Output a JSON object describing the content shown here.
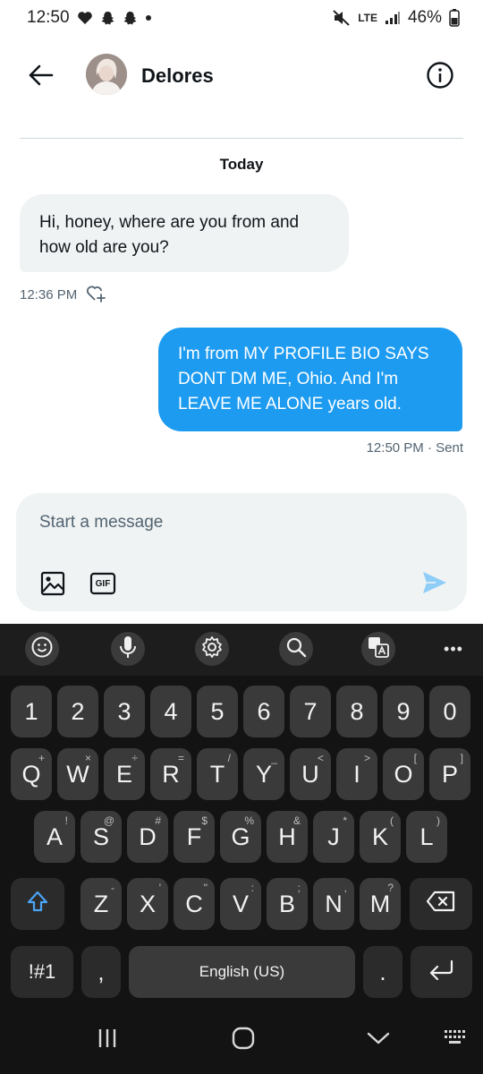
{
  "status_bar": {
    "time": "12:50",
    "network": "LTE",
    "battery": "46%",
    "icons": [
      "heart-icon",
      "snapchat-icon",
      "snapchat-icon",
      "dot-icon",
      "mute-icon",
      "signal-icon",
      "battery-icon"
    ]
  },
  "header": {
    "contact_name": "Delores",
    "back_icon": "arrow-left-icon",
    "info_icon": "info-icon"
  },
  "conversation": {
    "date_label": "Today",
    "messages": [
      {
        "direction": "incoming",
        "text": "Hi, honey, where are you from and how old are you?",
        "time": "12:36 PM"
      },
      {
        "direction": "outgoing",
        "text": "I'm from MY PROFILE BIO SAYS DONT DM ME, Ohio. And I'm LEAVE ME ALONE years old.",
        "time": "12:50 PM · Sent"
      }
    ]
  },
  "composer": {
    "placeholder": "Start a message",
    "gif_label": "GIF",
    "accent_color": "#1d9bf0"
  },
  "keyboard": {
    "toolbar": [
      "emoji-icon",
      "microphone-icon",
      "settings-icon",
      "search-icon",
      "translate-icon",
      "more-icon"
    ],
    "more_label": "•••",
    "number_row": [
      "1",
      "2",
      "3",
      "4",
      "5",
      "6",
      "7",
      "8",
      "9",
      "0"
    ],
    "row1": [
      {
        "key": "Q",
        "sub": "+"
      },
      {
        "key": "W",
        "sub": "×"
      },
      {
        "key": "E",
        "sub": "÷"
      },
      {
        "key": "R",
        "sub": "="
      },
      {
        "key": "T",
        "sub": "/"
      },
      {
        "key": "Y",
        "sub": "_"
      },
      {
        "key": "U",
        "sub": "<"
      },
      {
        "key": "I",
        "sub": ">"
      },
      {
        "key": "O",
        "sub": "["
      },
      {
        "key": "P",
        "sub": "]"
      }
    ],
    "row2": [
      {
        "key": "A",
        "sub": "!"
      },
      {
        "key": "S",
        "sub": "@"
      },
      {
        "key": "D",
        "sub": "#"
      },
      {
        "key": "F",
        "sub": "$"
      },
      {
        "key": "G",
        "sub": "%"
      },
      {
        "key": "H",
        "sub": "&"
      },
      {
        "key": "J",
        "sub": "*"
      },
      {
        "key": "K",
        "sub": "("
      },
      {
        "key": "L",
        "sub": ")"
      }
    ],
    "row3": [
      {
        "key": "Z",
        "sub": "-"
      },
      {
        "key": "X",
        "sub": "'"
      },
      {
        "key": "C",
        "sub": "\""
      },
      {
        "key": "V",
        "sub": ":"
      },
      {
        "key": "B",
        "sub": ";"
      },
      {
        "key": "N",
        "sub": ","
      },
      {
        "key": "M",
        "sub": "?"
      }
    ],
    "symbols_label": "!#1",
    "comma_label": ",",
    "space_label": "English (US)",
    "period_label": ".",
    "shift_icon": "shift-icon",
    "backspace_icon": "backspace-icon",
    "enter_icon": "enter-icon"
  },
  "navigation": [
    "recents-icon",
    "home-icon",
    "back-chevron-icon",
    "keyboard-switch-icon"
  ]
}
